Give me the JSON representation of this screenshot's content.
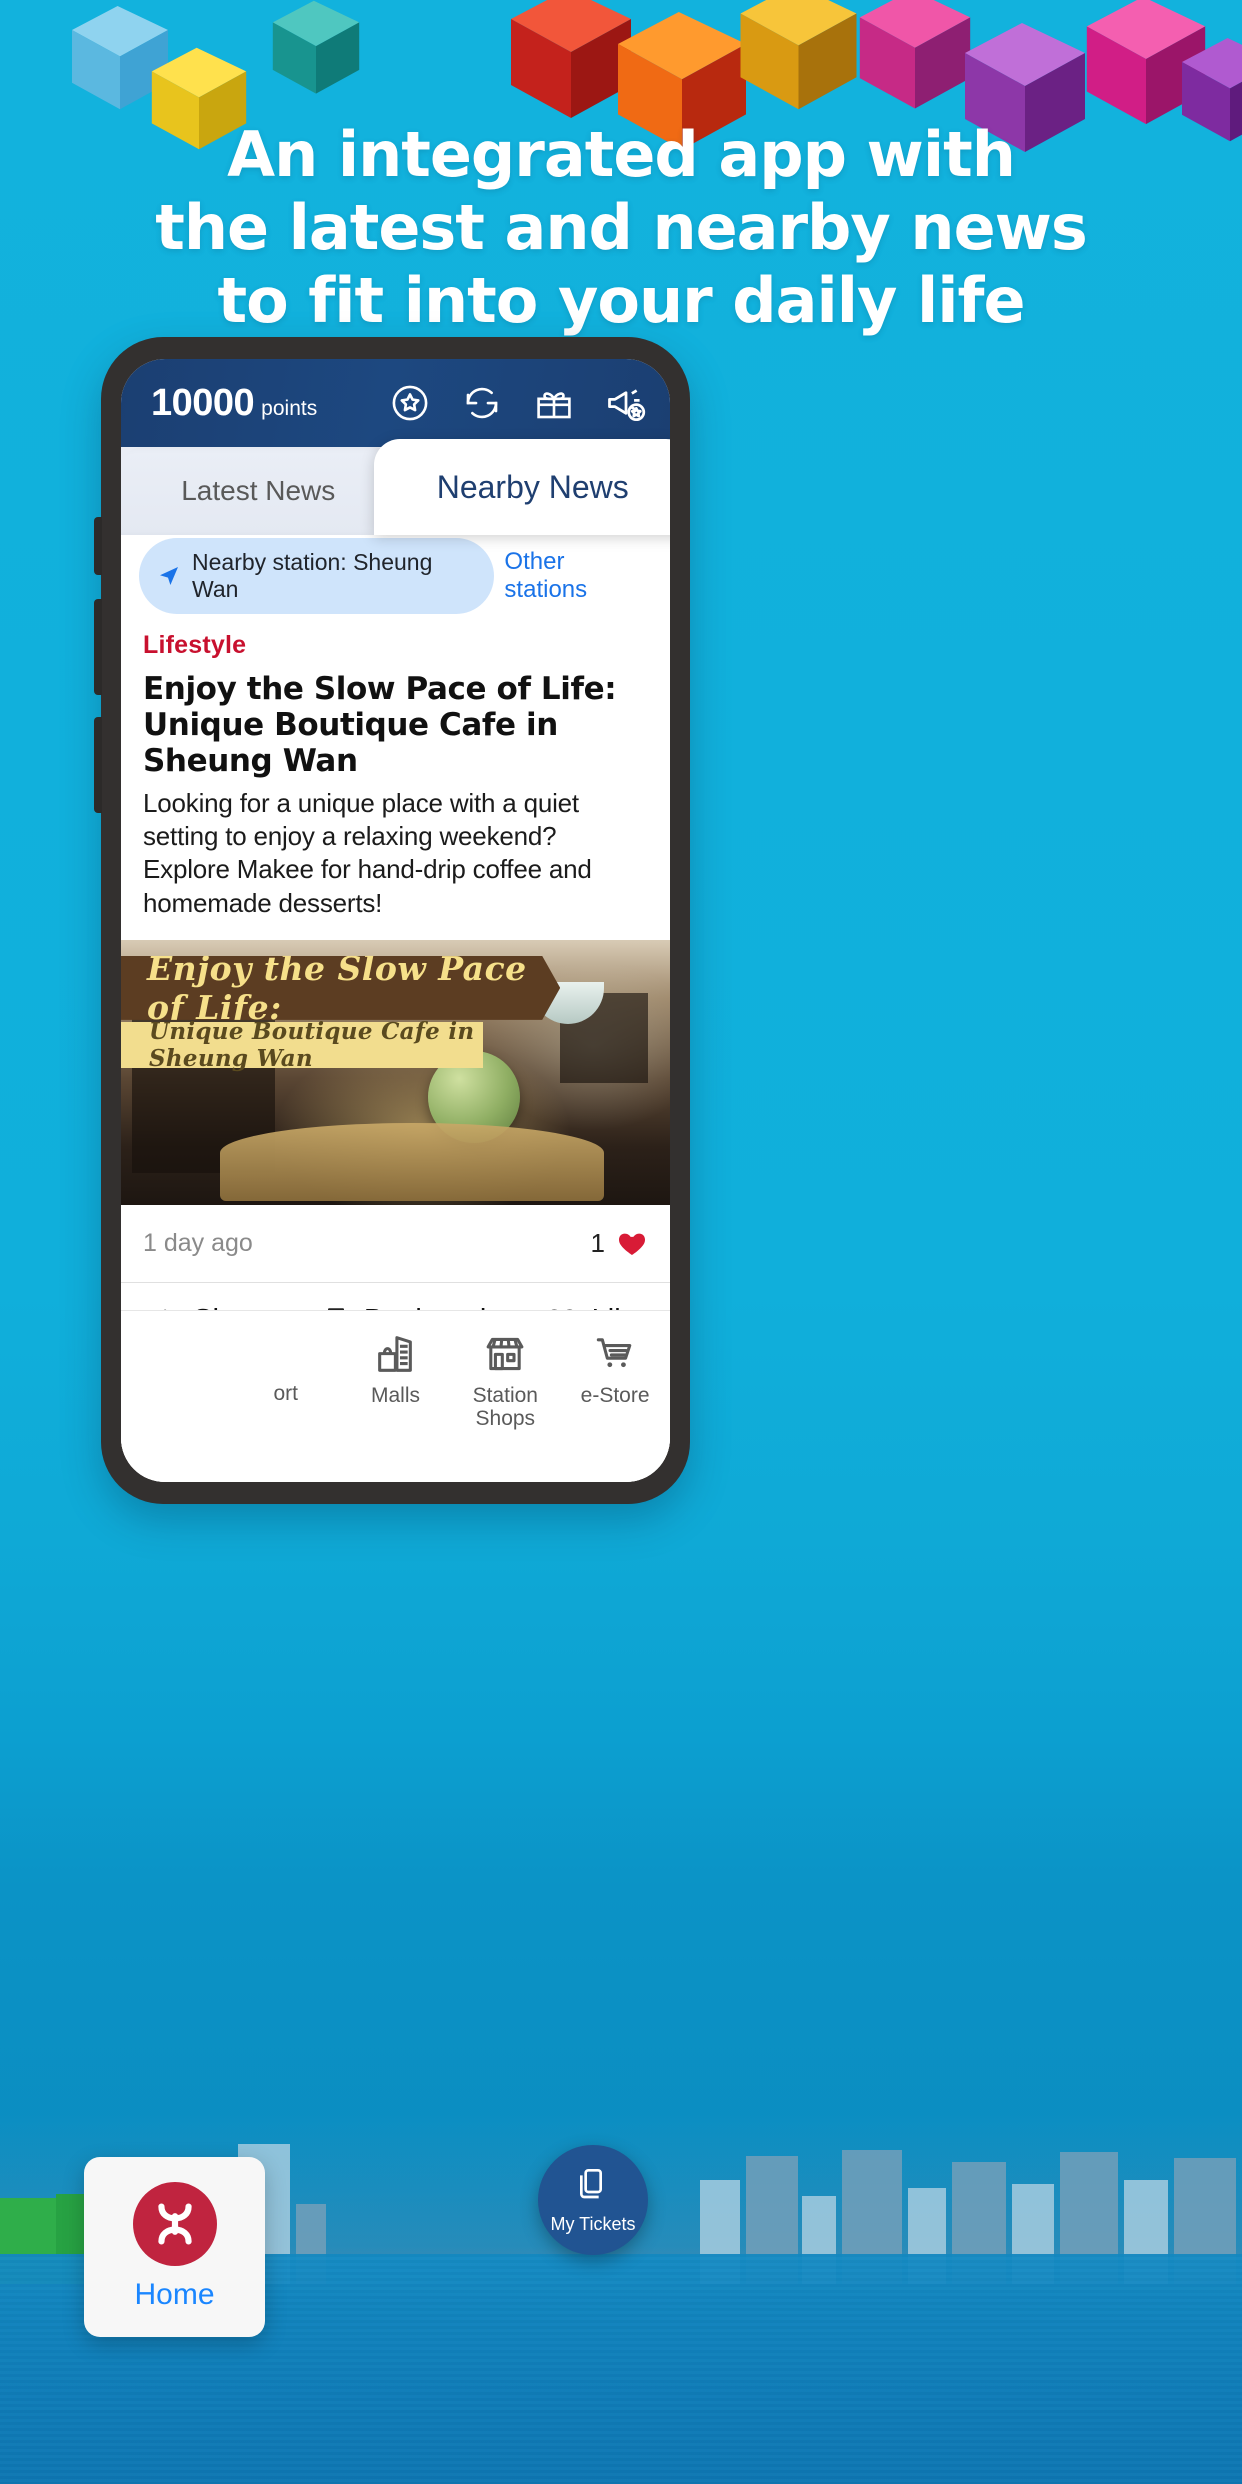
{
  "headline": {
    "line1": "An integrated app with",
    "line2": "the latest and nearby news",
    "line3": "to fit into your daily life"
  },
  "colors": {
    "background": "#0fb0dc",
    "appbar": "#1d4880",
    "accent_link": "#1a73e8",
    "category": "#c8102e",
    "mtr_red": "#c0243f",
    "fab": "#215492"
  },
  "app": {
    "appbar": {
      "points_value": "10000",
      "points_label": "points",
      "icons": [
        {
          "name": "star-circle-icon",
          "label": "Rewards"
        },
        {
          "name": "refresh-icon",
          "label": "Refresh"
        },
        {
          "name": "gift-icon",
          "label": "Gifts"
        },
        {
          "name": "megaphone-star-icon",
          "label": "Promotions"
        }
      ]
    },
    "tabs": [
      {
        "label": "Latest News",
        "active": false
      },
      {
        "label": "Nearby News",
        "active": true
      }
    ],
    "station_bar": {
      "chip_icon": "navigation-arrow-icon",
      "chip_label": "Nearby station: Sheung Wan",
      "other_stations_label": "Other stations"
    },
    "article": {
      "category": "Lifestyle",
      "title": "Enjoy the Slow Pace of Life: Unique Boutique Cafe in Sheung Wan",
      "summary": "Looking for a unique place with a quiet setting to enjoy a relaxing weekend? Explore Makee for hand-drip coffee and homemade desserts!",
      "image_banner_top": "Enjoy the Slow Pace of Life:",
      "image_banner_bottom": "Unique Boutique Cafe in Sheung Wan",
      "time_ago": "1 day ago",
      "like_count": "1"
    },
    "actions": [
      {
        "icon": "share-icon",
        "label": "Share"
      },
      {
        "icon": "bookmark-icon",
        "label": "Bookmark"
      },
      {
        "icon": "heart-outline-icon",
        "label": "Like"
      }
    ],
    "bottom_nav": [
      {
        "icon": "transport-icon",
        "label": "ort"
      },
      {
        "icon": "malls-icon",
        "label": "Malls"
      },
      {
        "icon": "station-shops-icon",
        "label": "Station\nShops"
      },
      {
        "icon": "cart-icon",
        "label": "e-Store"
      }
    ],
    "home_card": {
      "icon": "mtr-logo-icon",
      "label": "Home"
    },
    "fab": {
      "icon": "tickets-icon",
      "label": "My Tickets"
    }
  }
}
